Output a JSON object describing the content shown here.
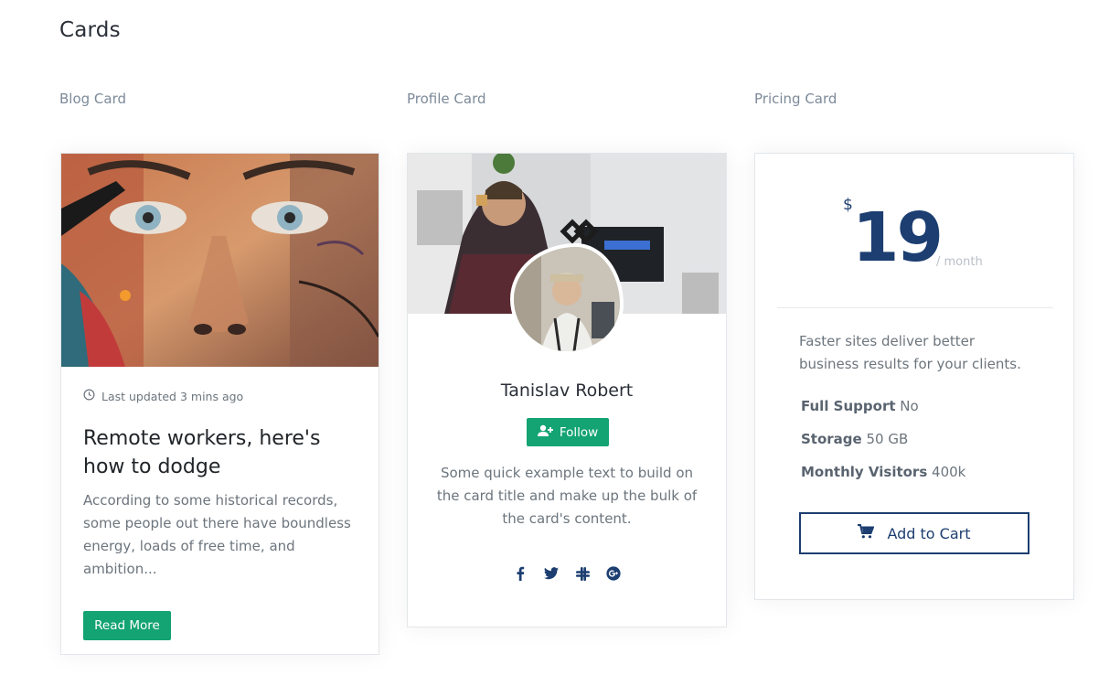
{
  "page": {
    "title": "Cards"
  },
  "sections": {
    "blog": "Blog Card",
    "profile": "Profile Card",
    "pricing": "Pricing Card"
  },
  "blog_card": {
    "image": "graffiti-face-mural",
    "meta": "Last updated 3 mins ago",
    "title": "Remote workers, here's how to dodge",
    "text": "According to some historical records, some people out there have boundless energy, loads of free time, and ambition...",
    "button": "Read More",
    "button_color": "#14a373"
  },
  "profile_card": {
    "cover_image": "person-at-desk-photo",
    "avatar_image": "portrait-photo",
    "name": "Tanislav Robert",
    "follow_label": "Follow",
    "text": "Some quick example text to build on the card title and make up the bulk of the card's content.",
    "social_icons": [
      "facebook-icon",
      "twitter-icon",
      "slack-icon",
      "google-plus-icon"
    ]
  },
  "pricing_card": {
    "currency": "$",
    "price": "19",
    "period": "/ month",
    "description": "Faster sites deliver better business results for your clients.",
    "features": [
      {
        "label": "Full Support",
        "value": "No"
      },
      {
        "label": "Storage",
        "value": "50 GB"
      },
      {
        "label": "Monthly Visitors",
        "value": "400k"
      }
    ],
    "button": "Add to Cart",
    "accent_color": "#1c3e70"
  }
}
